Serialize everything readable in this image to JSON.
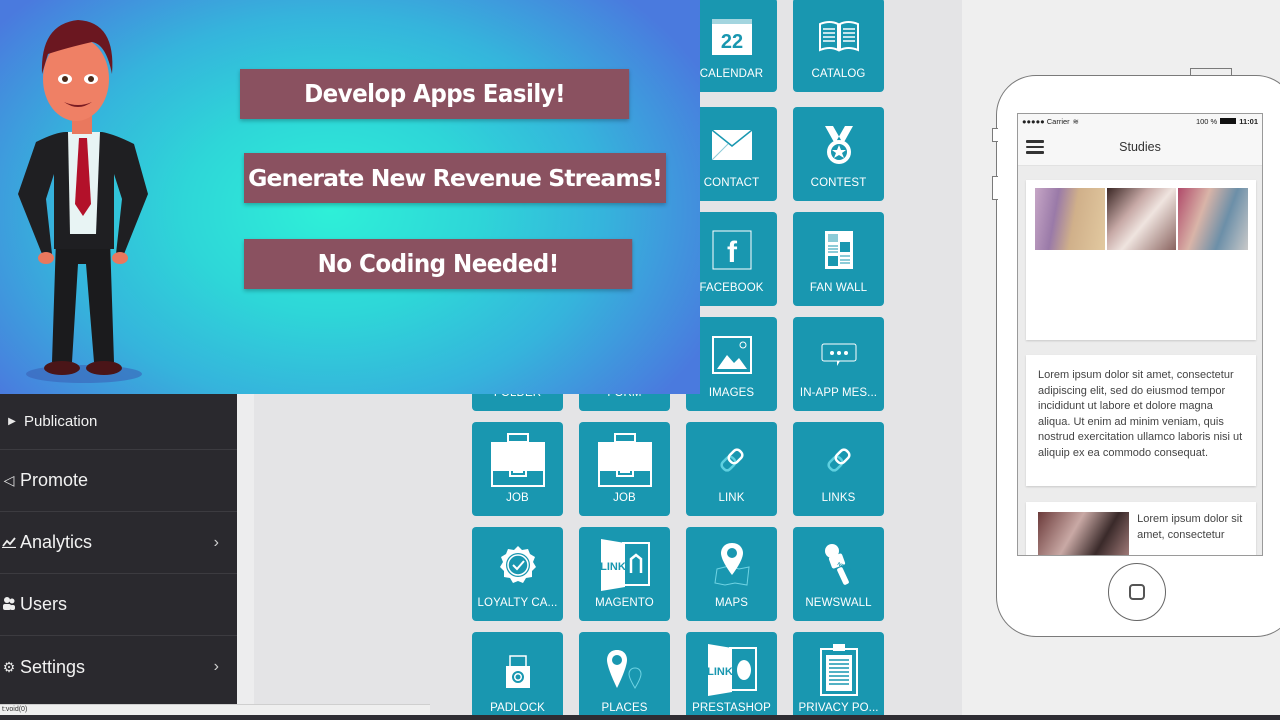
{
  "banner": {
    "slogans": [
      "Develop Apps  Easily!",
      "Generate New Revenue Streams!",
      "No Coding Needed!"
    ],
    "character": "businessman-cartoon"
  },
  "sidebar": {
    "items": [
      {
        "label": "Publication",
        "icon": "caret-right-icon",
        "sub": true
      },
      {
        "label": "Promote",
        "icon": "megaphone-icon"
      },
      {
        "label": "Analytics",
        "icon": "chart-line-icon",
        "chevron": true
      },
      {
        "label": "Users",
        "icon": "users-icon"
      },
      {
        "label": "Settings",
        "icon": "gear-icon",
        "chevron": true
      }
    ]
  },
  "status_bar": {
    "text": "t:void(0)"
  },
  "modules": {
    "tiles": [
      {
        "label": "CALENDAR",
        "icon": "calendar-icon",
        "icon_text": "22"
      },
      {
        "label": "CATALOG",
        "icon": "book-icon"
      },
      {
        "label": "CONTACT",
        "icon": "envelope-icon"
      },
      {
        "label": "CONTEST",
        "icon": "medal-icon"
      },
      {
        "label": "FACEBOOK",
        "icon": "facebook-icon",
        "icon_text": "f"
      },
      {
        "label": "FAN WALL",
        "icon": "newspaper-icon"
      },
      {
        "label": "FOLDER",
        "icon": "folder-icon"
      },
      {
        "label": "FORM",
        "icon": "form-icon"
      },
      {
        "label": "IMAGES",
        "icon": "image-icon"
      },
      {
        "label": "IN-APP MES...",
        "icon": "chat-bubble-icon"
      },
      {
        "label": "JOB",
        "icon": "briefcase-icon"
      },
      {
        "label": "JOB",
        "icon": "briefcase-icon"
      },
      {
        "label": "LINK",
        "icon": "link-icon"
      },
      {
        "label": "LINKS",
        "icon": "link-icon"
      },
      {
        "label": "LOYALTY CA...",
        "icon": "badge-check-icon"
      },
      {
        "label": "MAGENTO",
        "icon": "magento-icon",
        "icon_text": "LINK"
      },
      {
        "label": "MAPS",
        "icon": "map-pin-icon"
      },
      {
        "label": "NEWSWALL",
        "icon": "microphone-icon"
      },
      {
        "label": "PADLOCK",
        "icon": "padlock-icon"
      },
      {
        "label": "PLACES",
        "icon": "places-icon"
      },
      {
        "label": "PRESTASHOP",
        "icon": "prestashop-icon",
        "icon_text": "LINK"
      },
      {
        "label": "PRIVACY PO...",
        "icon": "clipboard-icon"
      }
    ]
  },
  "phone": {
    "status": {
      "carrier": "●●●●● Carrier",
      "battery": "100 %",
      "time": "11:01"
    },
    "title": "Studies",
    "paragraph": "Lorem ipsum dolor sit amet, consectetur adipiscing elit, sed do eiusmod tempor incididunt ut labore et dolore magna aliqua. Ut enim ad minim veniam, quis nostrud exercitation ullamco laboris nisi ut aliquip ex ea commodo consequat.",
    "snippet": "Lorem ipsum dolor sit amet, consectetur"
  },
  "colors": {
    "tile": "#1997b0",
    "slogan_bg": "#8a5160",
    "sidebar_bg": "#2a292e"
  }
}
